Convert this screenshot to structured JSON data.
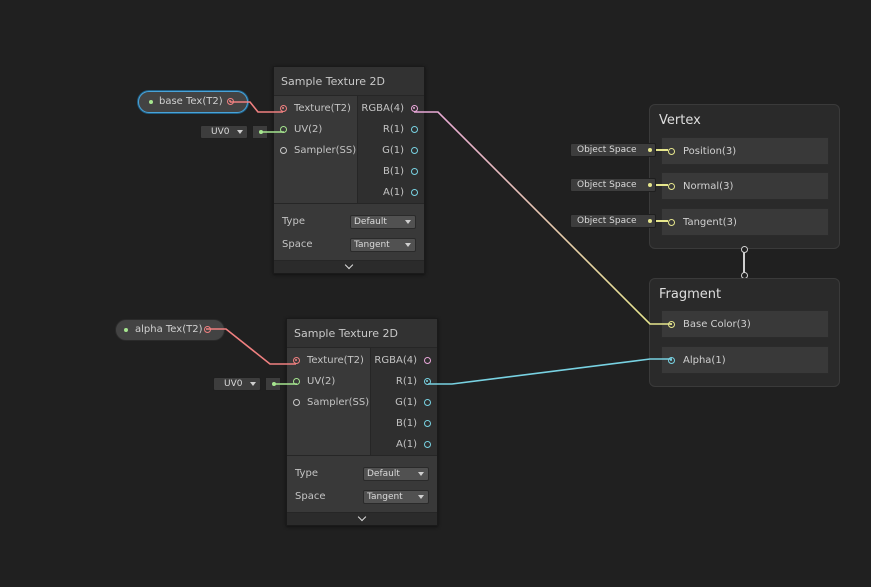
{
  "property_nodes": {
    "base_tex": "base Tex(T2)",
    "alpha_tex": "alpha Tex(T2)"
  },
  "uv_fields": {
    "top": "UV0",
    "bottom": "UV0"
  },
  "sample_node_top": {
    "title": "Sample Texture 2D",
    "inputs": [
      "Texture(T2)",
      "UV(2)",
      "Sampler(SS)"
    ],
    "outputs": [
      "RGBA(4)",
      "R(1)",
      "G(1)",
      "B(1)",
      "A(1)"
    ],
    "type_label": "Type",
    "type_value": "Default",
    "space_label": "Space",
    "space_value": "Tangent"
  },
  "sample_node_bottom": {
    "title": "Sample Texture 2D",
    "inputs": [
      "Texture(T2)",
      "UV(2)",
      "Sampler(SS)"
    ],
    "outputs": [
      "RGBA(4)",
      "R(1)",
      "G(1)",
      "B(1)",
      "A(1)"
    ],
    "type_label": "Type",
    "type_value": "Default",
    "space_label": "Space",
    "space_value": "Tangent"
  },
  "vertex": {
    "title": "Vertex",
    "ports": [
      "Position(3)",
      "Normal(3)",
      "Tangent(3)"
    ],
    "spaces": [
      "Object Space",
      "Object Space",
      "Object Space"
    ]
  },
  "fragment": {
    "title": "Fragment",
    "ports": [
      "Base Color(3)",
      "Alpha(1)"
    ]
  },
  "colors": {
    "texture_port": "#f08080",
    "uv_port": "#a6e68f",
    "vector4_port": "#e8a6d8",
    "float_port": "#78d2e2",
    "vector3_port": "#e6e68c",
    "selection": "#4aa3d8"
  }
}
